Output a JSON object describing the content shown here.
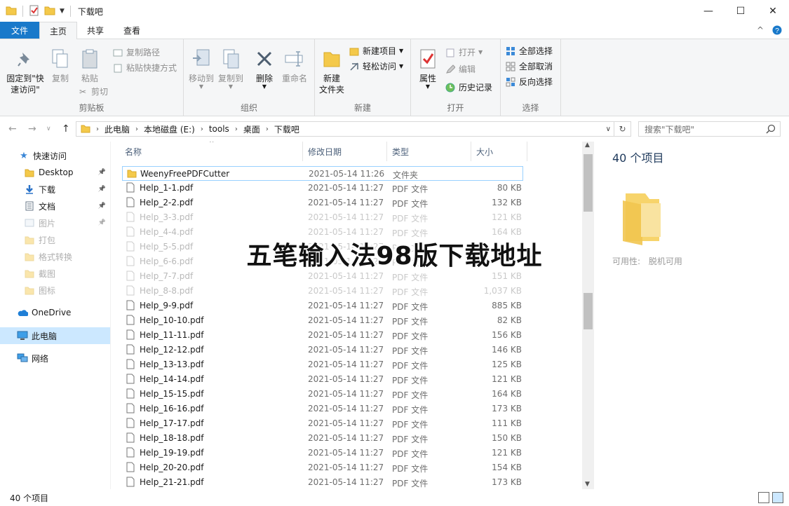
{
  "window": {
    "title": "下载吧",
    "controls": {
      "minimize": "—",
      "maximize": "☐",
      "close": "✕"
    }
  },
  "ribbon_tabs": [
    "文件",
    "主页",
    "共享",
    "查看"
  ],
  "ribbon": {
    "clipboard": {
      "pin": "固定到\"快速访问\"",
      "copy": "复制",
      "paste": "粘贴",
      "copy_path": "复制路径",
      "paste_shortcut": "粘贴快捷方式",
      "cut": "剪切",
      "label": "剪贴板"
    },
    "organize": {
      "move_to": "移动到",
      "copy_to": "复制到",
      "delete": "删除",
      "rename": "重命名",
      "label": "组织"
    },
    "new": {
      "new_folder": "新建\n文件夹",
      "new_item": "新建项目",
      "easy_access": "轻松访问",
      "label": "新建"
    },
    "open": {
      "properties": "属性",
      "open": "打开",
      "edit": "编辑",
      "history": "历史记录",
      "label": "打开"
    },
    "select": {
      "select_all": "全部选择",
      "select_none": "全部取消",
      "invert": "反向选择",
      "label": "选择"
    }
  },
  "address": {
    "breadcrumbs": [
      "此电脑",
      "本地磁盘 (E:)",
      "tools",
      "桌面",
      "下载吧"
    ],
    "search_placeholder": "搜索\"下载吧\""
  },
  "nav": {
    "quick_access": "快速访问",
    "items": [
      {
        "label": "Desktop",
        "pinned": true,
        "faded": false
      },
      {
        "label": "下载",
        "pinned": true,
        "faded": false
      },
      {
        "label": "文档",
        "pinned": true,
        "faded": false
      },
      {
        "label": "图片",
        "pinned": true,
        "faded": true
      },
      {
        "label": "打包",
        "pinned": false,
        "faded": true
      },
      {
        "label": "格式转换",
        "pinned": false,
        "faded": true
      },
      {
        "label": "截图",
        "pinned": false,
        "faded": true
      },
      {
        "label": "图标",
        "pinned": false,
        "faded": true
      }
    ],
    "onedrive": "OneDrive",
    "this_pc": "此电脑",
    "network": "网络"
  },
  "columns": {
    "name": "名称",
    "date": "修改日期",
    "type": "类型",
    "size": "大小"
  },
  "files": [
    {
      "name": "WeenyFreePDFCutter",
      "date": "2021-05-14 11:26",
      "type": "文件夹",
      "size": "",
      "kind": "folder",
      "faded": false
    },
    {
      "name": "Help_1-1.pdf",
      "date": "2021-05-14 11:27",
      "type": "PDF 文件",
      "size": "80 KB",
      "kind": "file",
      "faded": false
    },
    {
      "name": "Help_2-2.pdf",
      "date": "2021-05-14 11:27",
      "type": "PDF 文件",
      "size": "132 KB",
      "kind": "file",
      "faded": false
    },
    {
      "name": "Help_3-3.pdf",
      "date": "2021-05-14 11:27",
      "type": "PDF 文件",
      "size": "121 KB",
      "kind": "file",
      "faded": true
    },
    {
      "name": "Help_4-4.pdf",
      "date": "2021-05-14 11:27",
      "type": "PDF 文件",
      "size": "164 KB",
      "kind": "file",
      "faded": true
    },
    {
      "name": "Help_5-5.pdf",
      "date": "2021-05-14 11:27",
      "type": "PDF 文件",
      "size": "",
      "kind": "file",
      "faded": true
    },
    {
      "name": "Help_6-6.pdf",
      "date": "2021-05-14 11:27",
      "type": "PDF 文件",
      "size": "",
      "kind": "file",
      "faded": true
    },
    {
      "name": "Help_7-7.pdf",
      "date": "2021-05-14 11:27",
      "type": "PDF 文件",
      "size": "151 KB",
      "kind": "file",
      "faded": true
    },
    {
      "name": "Help_8-8.pdf",
      "date": "2021-05-14 11:27",
      "type": "PDF 文件",
      "size": "1,037 KB",
      "kind": "file",
      "faded": true
    },
    {
      "name": "Help_9-9.pdf",
      "date": "2021-05-14 11:27",
      "type": "PDF 文件",
      "size": "885 KB",
      "kind": "file",
      "faded": false
    },
    {
      "name": "Help_10-10.pdf",
      "date": "2021-05-14 11:27",
      "type": "PDF 文件",
      "size": "82 KB",
      "kind": "file",
      "faded": false
    },
    {
      "name": "Help_11-11.pdf",
      "date": "2021-05-14 11:27",
      "type": "PDF 文件",
      "size": "156 KB",
      "kind": "file",
      "faded": false
    },
    {
      "name": "Help_12-12.pdf",
      "date": "2021-05-14 11:27",
      "type": "PDF 文件",
      "size": "146 KB",
      "kind": "file",
      "faded": false
    },
    {
      "name": "Help_13-13.pdf",
      "date": "2021-05-14 11:27",
      "type": "PDF 文件",
      "size": "125 KB",
      "kind": "file",
      "faded": false
    },
    {
      "name": "Help_14-14.pdf",
      "date": "2021-05-14 11:27",
      "type": "PDF 文件",
      "size": "121 KB",
      "kind": "file",
      "faded": false
    },
    {
      "name": "Help_15-15.pdf",
      "date": "2021-05-14 11:27",
      "type": "PDF 文件",
      "size": "164 KB",
      "kind": "file",
      "faded": false
    },
    {
      "name": "Help_16-16.pdf",
      "date": "2021-05-14 11:27",
      "type": "PDF 文件",
      "size": "173 KB",
      "kind": "file",
      "faded": false
    },
    {
      "name": "Help_17-17.pdf",
      "date": "2021-05-14 11:27",
      "type": "PDF 文件",
      "size": "111 KB",
      "kind": "file",
      "faded": false
    },
    {
      "name": "Help_18-18.pdf",
      "date": "2021-05-14 11:27",
      "type": "PDF 文件",
      "size": "150 KB",
      "kind": "file",
      "faded": false
    },
    {
      "name": "Help_19-19.pdf",
      "date": "2021-05-14 11:27",
      "type": "PDF 文件",
      "size": "121 KB",
      "kind": "file",
      "faded": false
    },
    {
      "name": "Help_20-20.pdf",
      "date": "2021-05-14 11:27",
      "type": "PDF 文件",
      "size": "154 KB",
      "kind": "file",
      "faded": false
    },
    {
      "name": "Help_21-21.pdf",
      "date": "2021-05-14 11:27",
      "type": "PDF 文件",
      "size": "173 KB",
      "kind": "file",
      "faded": false
    }
  ],
  "preview": {
    "count": "40 个项目",
    "availability_label": "可用性:",
    "availability_value": "脱机可用"
  },
  "status": {
    "count": "40 个项目"
  },
  "overlay_text": "五笔输入法98版下载地址",
  "colors": {
    "accent": "#1979ca",
    "folder": "#f4c94a",
    "selected": "#cce8ff"
  }
}
